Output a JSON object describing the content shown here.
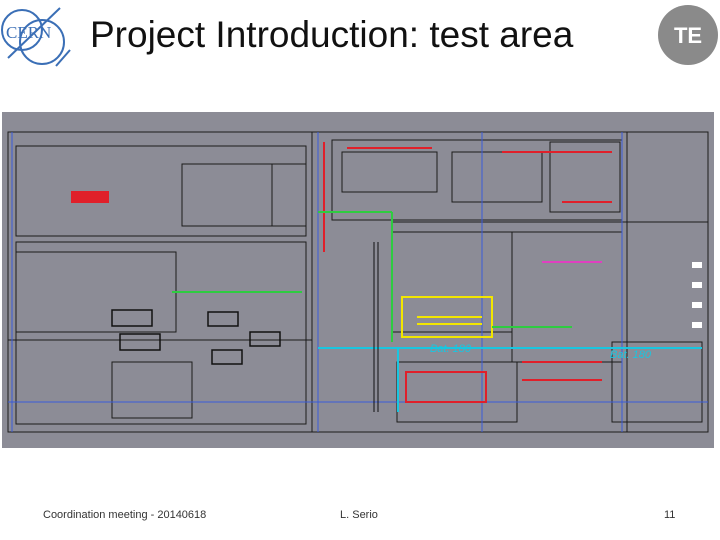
{
  "slide": {
    "title": "Project Introduction: test area",
    "footer_left": "Coordination meeting - 20140618",
    "footer_center": "L. Serio",
    "page_number": "11"
  },
  "logos": {
    "left": {
      "icon": "cern-logo",
      "text": "CERN",
      "color": "#3b6fb6"
    },
    "right": {
      "icon": "te-logo",
      "text": "TE",
      "color": "#8a8a8a"
    }
  },
  "floor_plan": {
    "icon": "engineering-floor-plan",
    "labels": [
      "Bat. 180",
      "Bat. 180"
    ],
    "colors": {
      "background": "#8c8c96",
      "lines": "#1b1b1b",
      "accent_red": "#e0202a",
      "accent_green": "#2ecc40",
      "accent_yellow": "#f2e600",
      "accent_blue": "#3a5bd9",
      "accent_cyan": "#19c6e0",
      "accent_magenta": "#e040c0"
    }
  }
}
